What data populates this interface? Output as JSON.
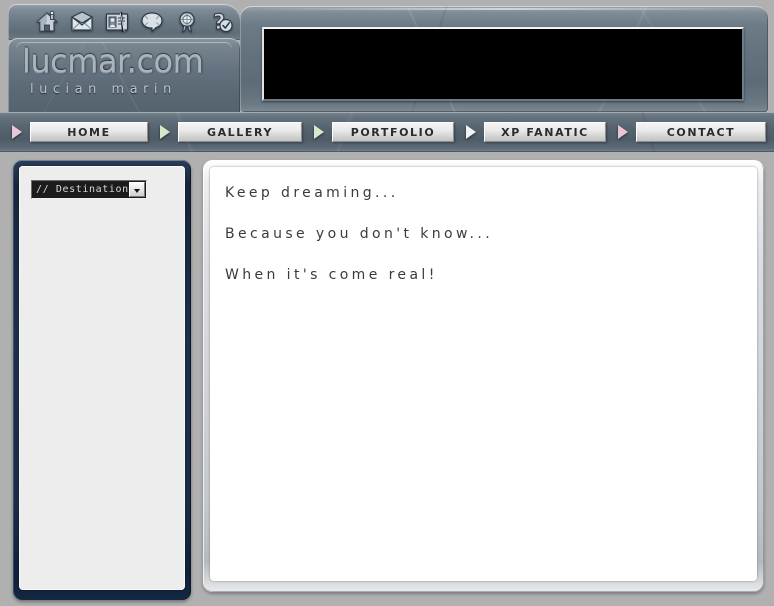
{
  "site": {
    "logo_main": "lucmar.com",
    "logo_sub": "lucian marin",
    "background_color": "#b0b0b0",
    "frame_color": "#65737f",
    "sidebar_frame_color": "#16253c"
  },
  "iconbar": {
    "icons": [
      {
        "name": "home-icon",
        "title": "Home"
      },
      {
        "name": "mail-icon",
        "title": "Mail"
      },
      {
        "name": "contact-card-icon",
        "title": "Contact card"
      },
      {
        "name": "speech-bubble-icon",
        "title": "Comments"
      },
      {
        "name": "award-icon",
        "title": "Awards"
      },
      {
        "name": "help-icon",
        "title": "Help"
      }
    ]
  },
  "banner": {
    "label": "",
    "background_color": "#000000"
  },
  "nav": {
    "items": [
      {
        "label": "HOME",
        "arrow_color": "#e8c8d8"
      },
      {
        "label": "GALLERY",
        "arrow_color": "#d6e8c8"
      },
      {
        "label": "PORTFOLIO",
        "arrow_color": "#d6e8c8"
      },
      {
        "label": "XP FANATIC",
        "arrow_color": "#f0f2f4"
      },
      {
        "label": "CONTACT",
        "arrow_color": "#eac6d4"
      }
    ]
  },
  "sidebar": {
    "destination_select": {
      "selected": "// Destination?",
      "options": [
        "// Destination?"
      ]
    }
  },
  "main": {
    "lines": [
      "Keep dreaming...",
      "Because you don't know...",
      "When it's come real!"
    ]
  }
}
